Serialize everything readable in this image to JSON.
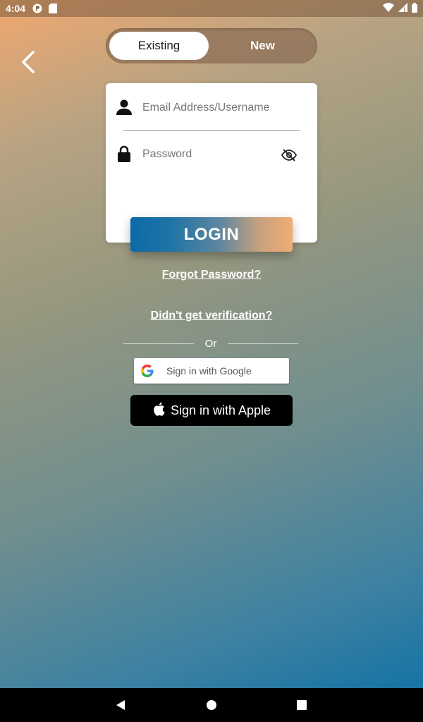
{
  "status_bar": {
    "time": "4:04"
  },
  "toggle": {
    "existing_label": "Existing",
    "new_label": "New"
  },
  "form": {
    "email_placeholder": "Email Address/Username",
    "password_placeholder": "Password"
  },
  "login_label": "LOGIN",
  "forgot_password": "Forgot Password?",
  "verification_link": "Didn't get verification?",
  "or_text": "Or",
  "google_label": "Sign in with Google",
  "apple_label": "Sign in with Apple",
  "icons": {
    "back": "chevron-left-icon",
    "user": "person-icon",
    "lock": "lock-icon",
    "eye": "eye-off-icon",
    "google": "google-g-icon",
    "apple": "apple-logo-icon"
  },
  "colors": {
    "gradient_top": "#f0a870",
    "gradient_bottom": "#0b6fa6",
    "login_left": "#0c6aa8",
    "login_right": "#f0ac74"
  }
}
